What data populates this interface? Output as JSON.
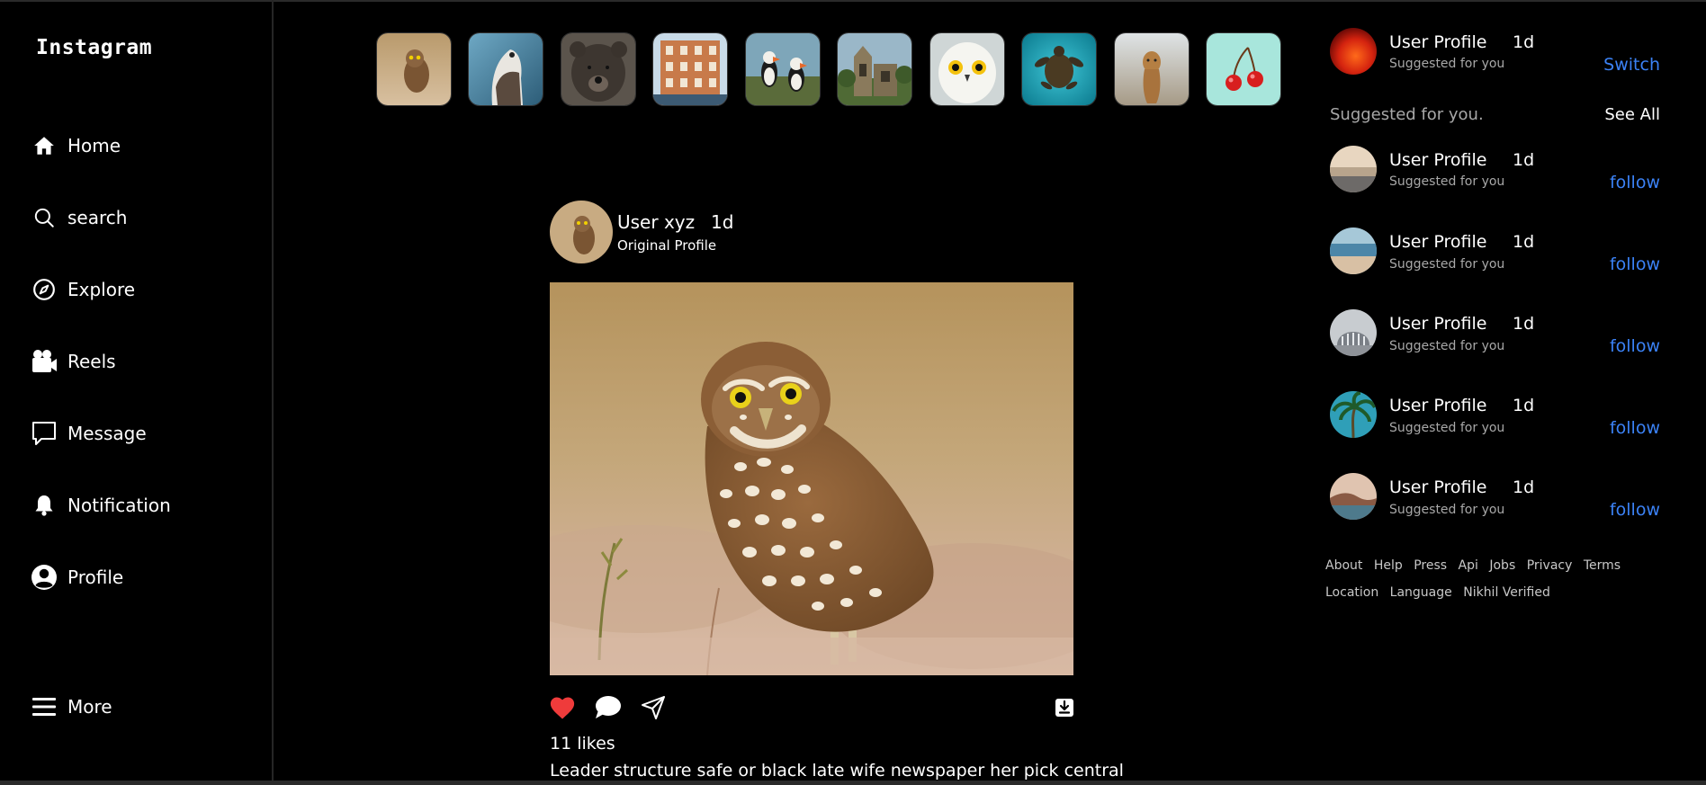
{
  "brand": "Instagram",
  "nav": [
    {
      "label": "Home",
      "icon": "home-icon"
    },
    {
      "label": "search",
      "icon": "search-icon"
    },
    {
      "label": "Explore",
      "icon": "compass-icon"
    },
    {
      "label": "Reels",
      "icon": "video-camera-icon"
    },
    {
      "label": "Message",
      "icon": "chat-bubble-icon"
    },
    {
      "label": "Notification",
      "icon": "bell-icon"
    },
    {
      "label": "Profile",
      "icon": "user-circle-icon"
    },
    {
      "label": "More",
      "icon": "hamburger-menu-icon"
    }
  ],
  "stories": [
    {
      "subject": "owl"
    },
    {
      "subject": "falcon"
    },
    {
      "subject": "bear"
    },
    {
      "subject": "building"
    },
    {
      "subject": "puffins"
    },
    {
      "subject": "ruins"
    },
    {
      "subject": "snowy-owl"
    },
    {
      "subject": "sea-turtle"
    },
    {
      "subject": "lion"
    },
    {
      "subject": "cherries"
    }
  ],
  "post": {
    "username": "User xyz",
    "time": "1d",
    "subtitle": "Original Profile",
    "likes": "11 likes",
    "caption": "Leader structure safe or black late wife newspaper her pick central",
    "liked": true,
    "like_color": "#ef3b3b"
  },
  "current_user": {
    "name": "User Profile",
    "time": "1d",
    "subtitle": "Suggested for you",
    "action": "Switch"
  },
  "suggestions": {
    "heading": "Suggested for you.",
    "see_all": "See All",
    "items": [
      {
        "name": "User Profile",
        "time": "1d",
        "subtitle": "Suggested for you",
        "action": "follow",
        "theme": "beach"
      },
      {
        "name": "User Profile",
        "time": "1d",
        "subtitle": "Suggested for you",
        "action": "follow",
        "theme": "shore"
      },
      {
        "name": "User Profile",
        "time": "1d",
        "subtitle": "Suggested for you",
        "action": "follow",
        "theme": "architecture"
      },
      {
        "name": "User Profile",
        "time": "1d",
        "subtitle": "Suggested for you",
        "action": "follow",
        "theme": "palm"
      },
      {
        "name": "User Profile",
        "time": "1d",
        "subtitle": "Suggested for you",
        "action": "follow",
        "theme": "coast"
      }
    ]
  },
  "footer_links": [
    "About",
    "Help",
    "Press",
    "Api",
    "Jobs",
    "Privacy",
    "Terms",
    "Location",
    "Language",
    "Nikhil Verified"
  ],
  "colors": {
    "background": "#000000",
    "link_blue": "#3b82f6",
    "muted": "#a8a8a8"
  }
}
